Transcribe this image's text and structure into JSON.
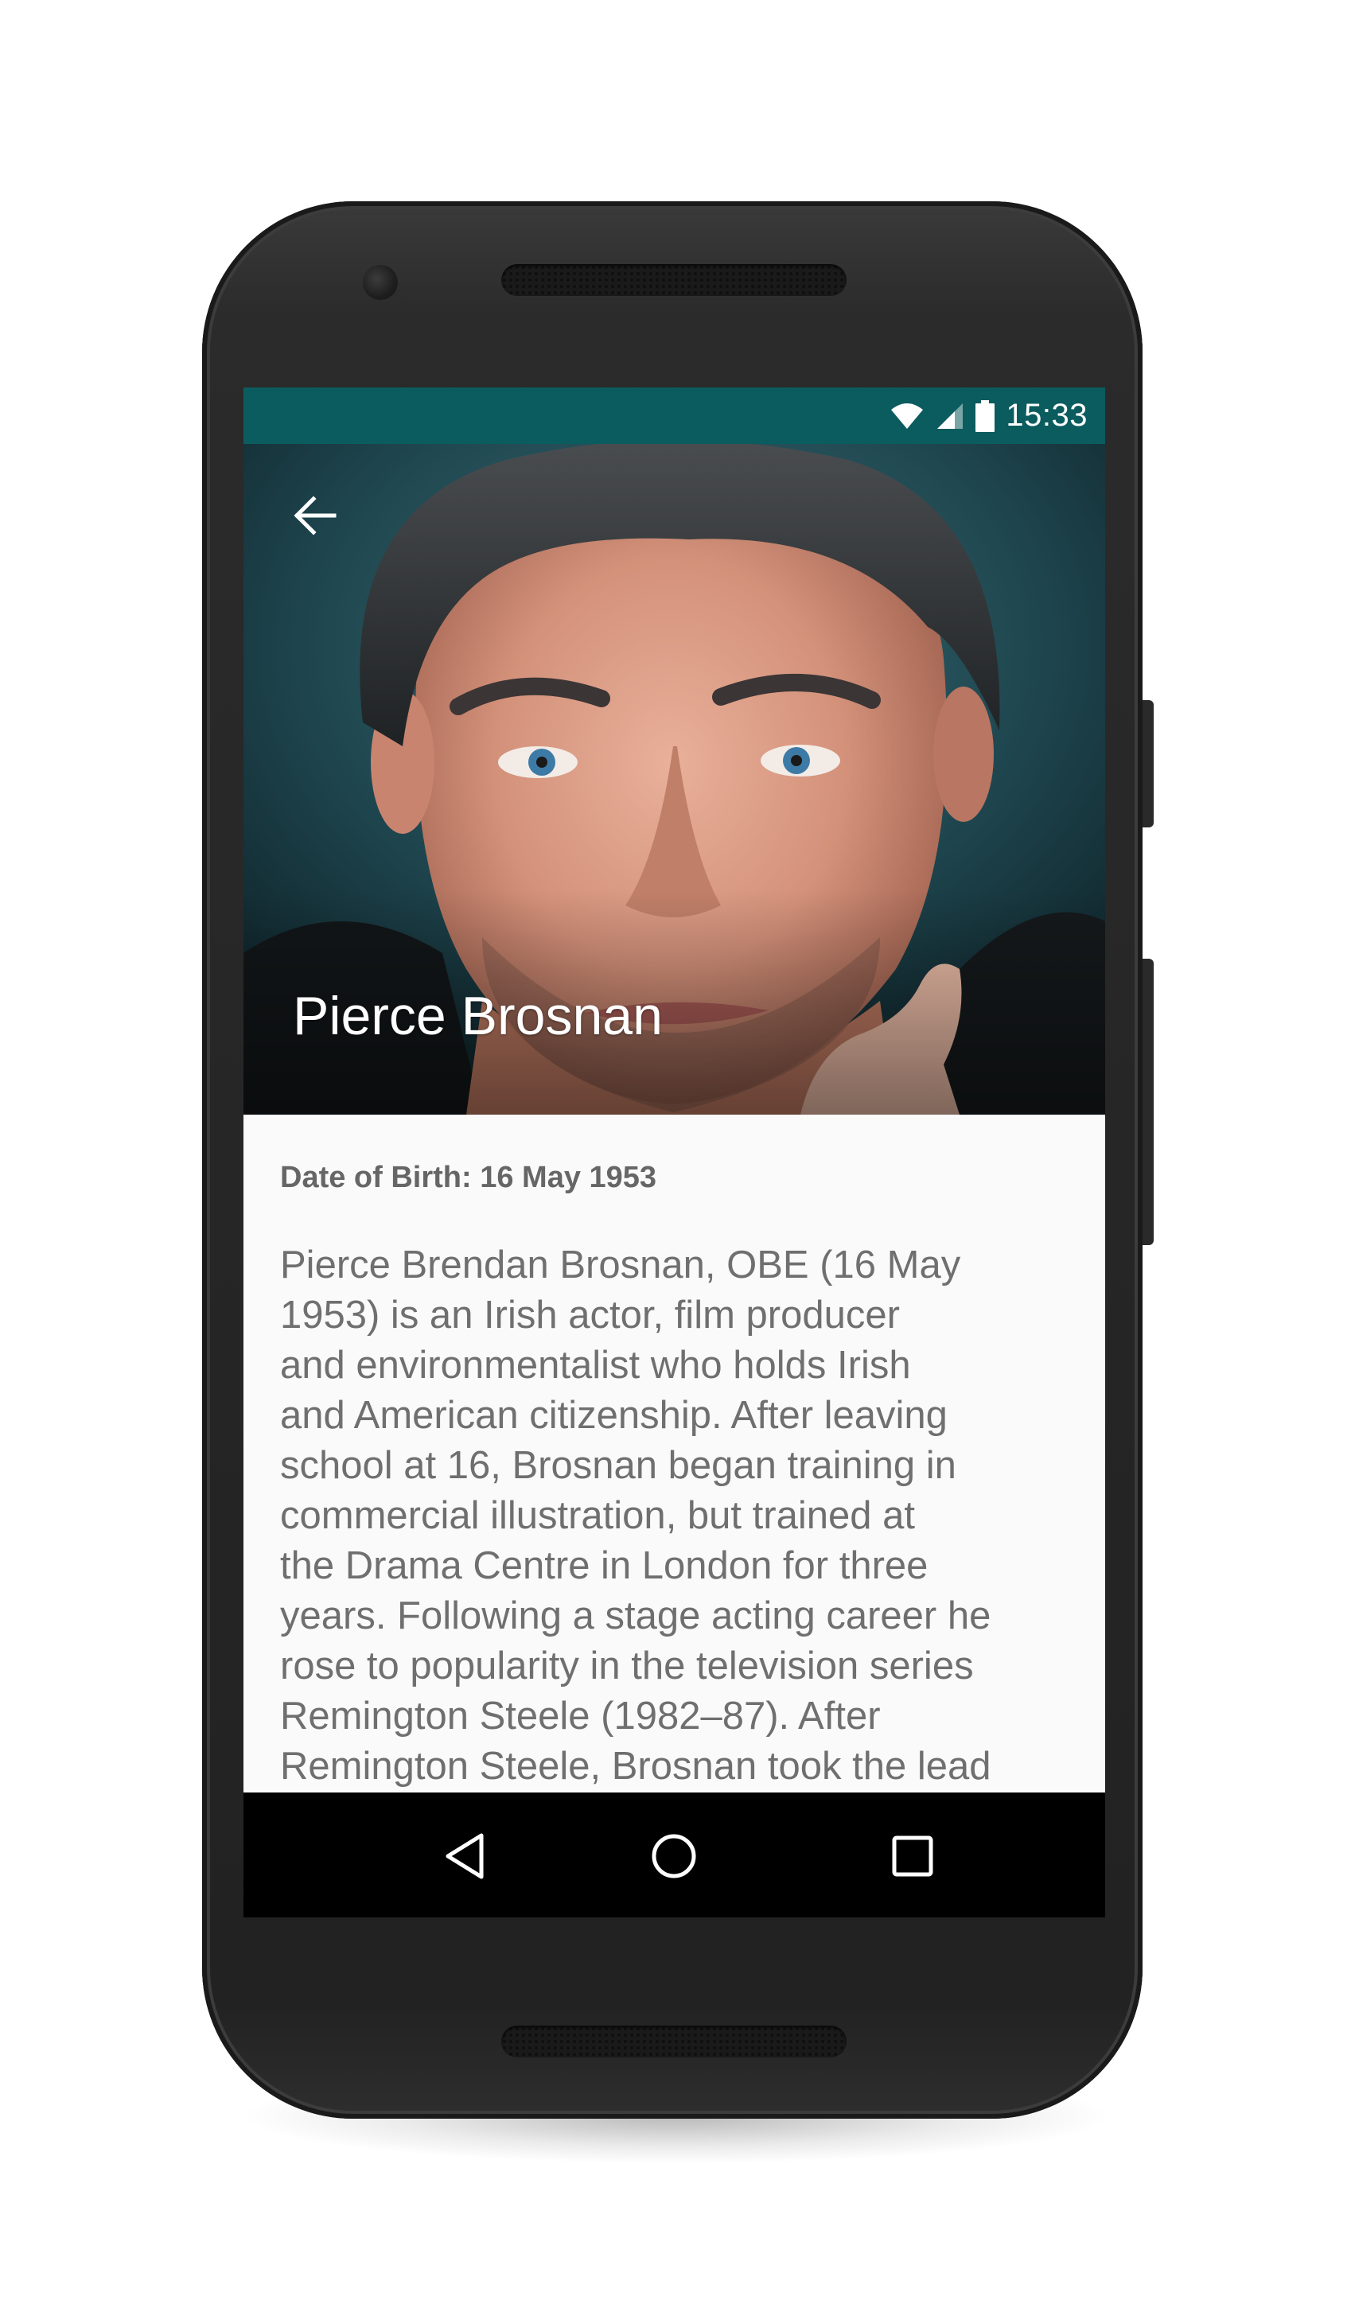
{
  "status_bar": {
    "time": "15:33",
    "icons": [
      "wifi-icon",
      "cell-signal-icon",
      "battery-icon"
    ],
    "color": "#0b5c5f"
  },
  "header": {
    "title": "Pierce Brosnan",
    "back_icon": "arrow-left-icon",
    "image": "portrait-photo"
  },
  "content": {
    "date_of_birth": "Date of Birth: 16 May 1953",
    "bio": "Pierce Brendan Brosnan, OBE (16 May\n1953) is an Irish actor, film  producer\nand environmentalist who holds Irish\nand American citizenship.  After leaving\nschool at 16, Brosnan began training in\ncommercial  illustration, but trained at\nthe Drama Centre in London for three\nyears.  Following a stage acting career he\nrose to popularity in the television  series\nRemington Steele (1982–87).  After\nRemington Steele, Brosnan took the lead"
  },
  "nav_bar": {
    "back_icon": "triangle-back-icon",
    "home_icon": "circle-home-icon",
    "recents_icon": "square-recents-icon"
  }
}
